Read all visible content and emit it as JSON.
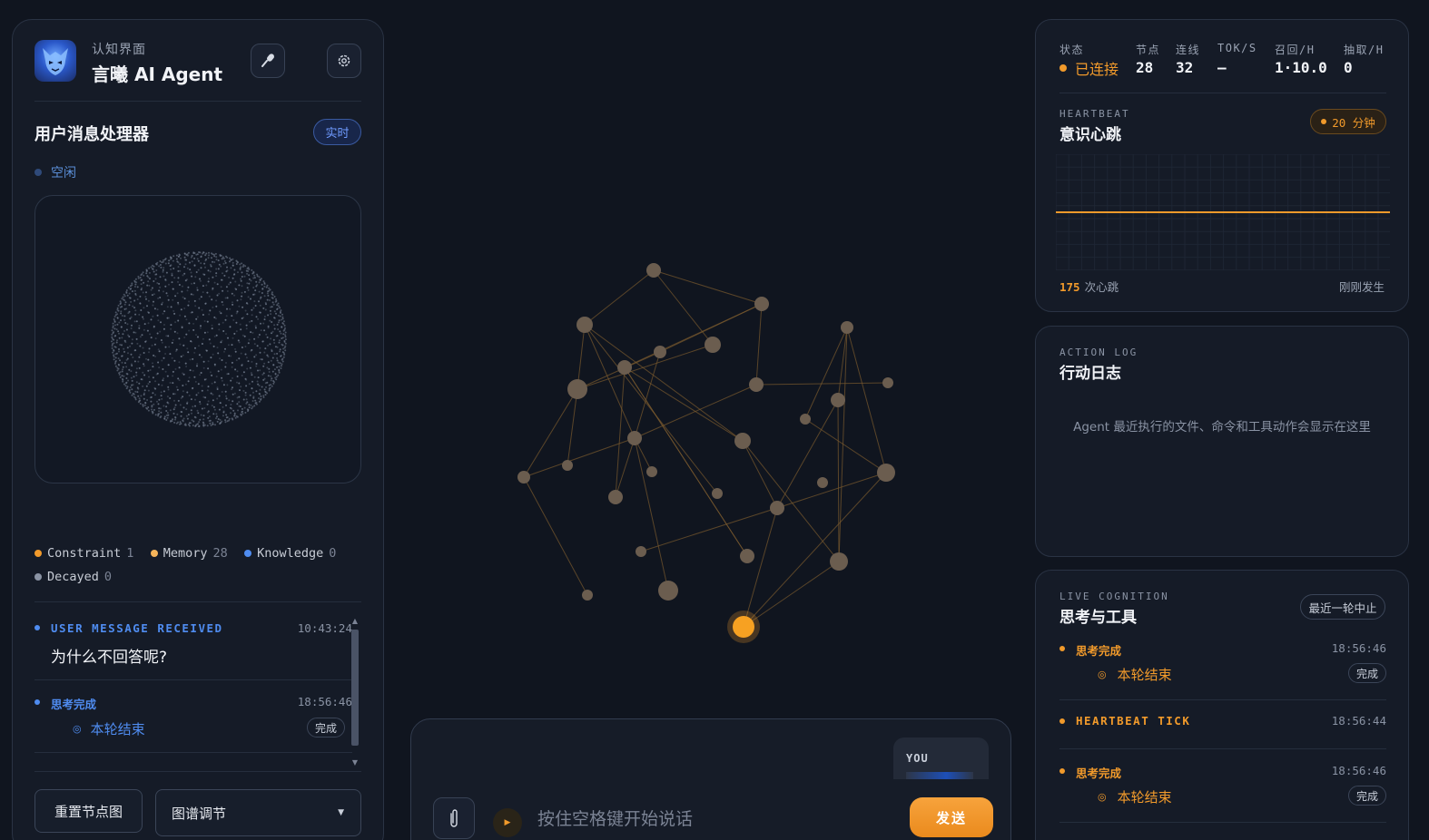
{
  "header": {
    "subtitle": "认知界面",
    "title": "言曦 AI Agent",
    "avatar_icon": "demon-mask-avatar",
    "mic_icon": "microphone-icon",
    "settings_icon": "gear-icon"
  },
  "processor": {
    "title": "用户消息处理器",
    "badge": "实时",
    "status": "空闲"
  },
  "legend": [
    {
      "label": "Constraint",
      "count": "1",
      "color": "#f19a2b"
    },
    {
      "label": "Memory",
      "count": "28",
      "color": "#f5b45a"
    },
    {
      "label": "Knowledge",
      "count": "0",
      "color": "#4f8cf0"
    },
    {
      "label": "Decayed",
      "count": "0",
      "color": "#8a93a4"
    }
  ],
  "events": [
    {
      "title": "USER MESSAGE RECEIVED",
      "time": "10:43:24",
      "message": "为什么不回答呢?"
    },
    {
      "title": "思考完成",
      "time": "18:56:46",
      "sub": "本轮结束",
      "pill": "完成"
    }
  ],
  "controls": {
    "reset": "重置节点图",
    "tune": "图谱调节"
  },
  "composer": {
    "you_label": "YOU",
    "voice_hint": "按住空格键开始说话",
    "send": "发送"
  },
  "stats": {
    "status_label": "状态",
    "status_value": "已连接",
    "nodes_label": "节点",
    "nodes_value": "28",
    "edges_label": "连线",
    "edges_value": "32",
    "tok_label": "TOK/S",
    "tok_value": "—",
    "recall_label": "召回/H",
    "recall_value": "1·10.0",
    "extract_label": "抽取/H",
    "extract_value": "0"
  },
  "heartbeat": {
    "eyebrow": "HEARTBEAT",
    "title": "意识心跳",
    "badge": "20 分钟",
    "count": "175",
    "count_label": "次心跳",
    "when": "刚刚发生"
  },
  "action_log": {
    "eyebrow": "ACTION LOG",
    "title": "行动日志",
    "empty": "Agent 最近执行的文件、命令和工具动作会显示在这里"
  },
  "cognition": {
    "eyebrow": "LIVE COGNITION",
    "title": "思考与工具",
    "recent": "最近一轮中止",
    "items": [
      {
        "title": "思考完成",
        "time": "18:56:46",
        "sub": "本轮结束",
        "pill": "完成"
      },
      {
        "title": "HEARTBEAT TICK",
        "time": "18:56:44"
      },
      {
        "title": "思考完成",
        "time": "18:56:46",
        "sub": "本轮结束",
        "pill": "完成"
      }
    ]
  },
  "colors": {
    "accent": "#f19a2b",
    "blue": "#4f8cf0",
    "node": "#6b5d4f"
  }
}
